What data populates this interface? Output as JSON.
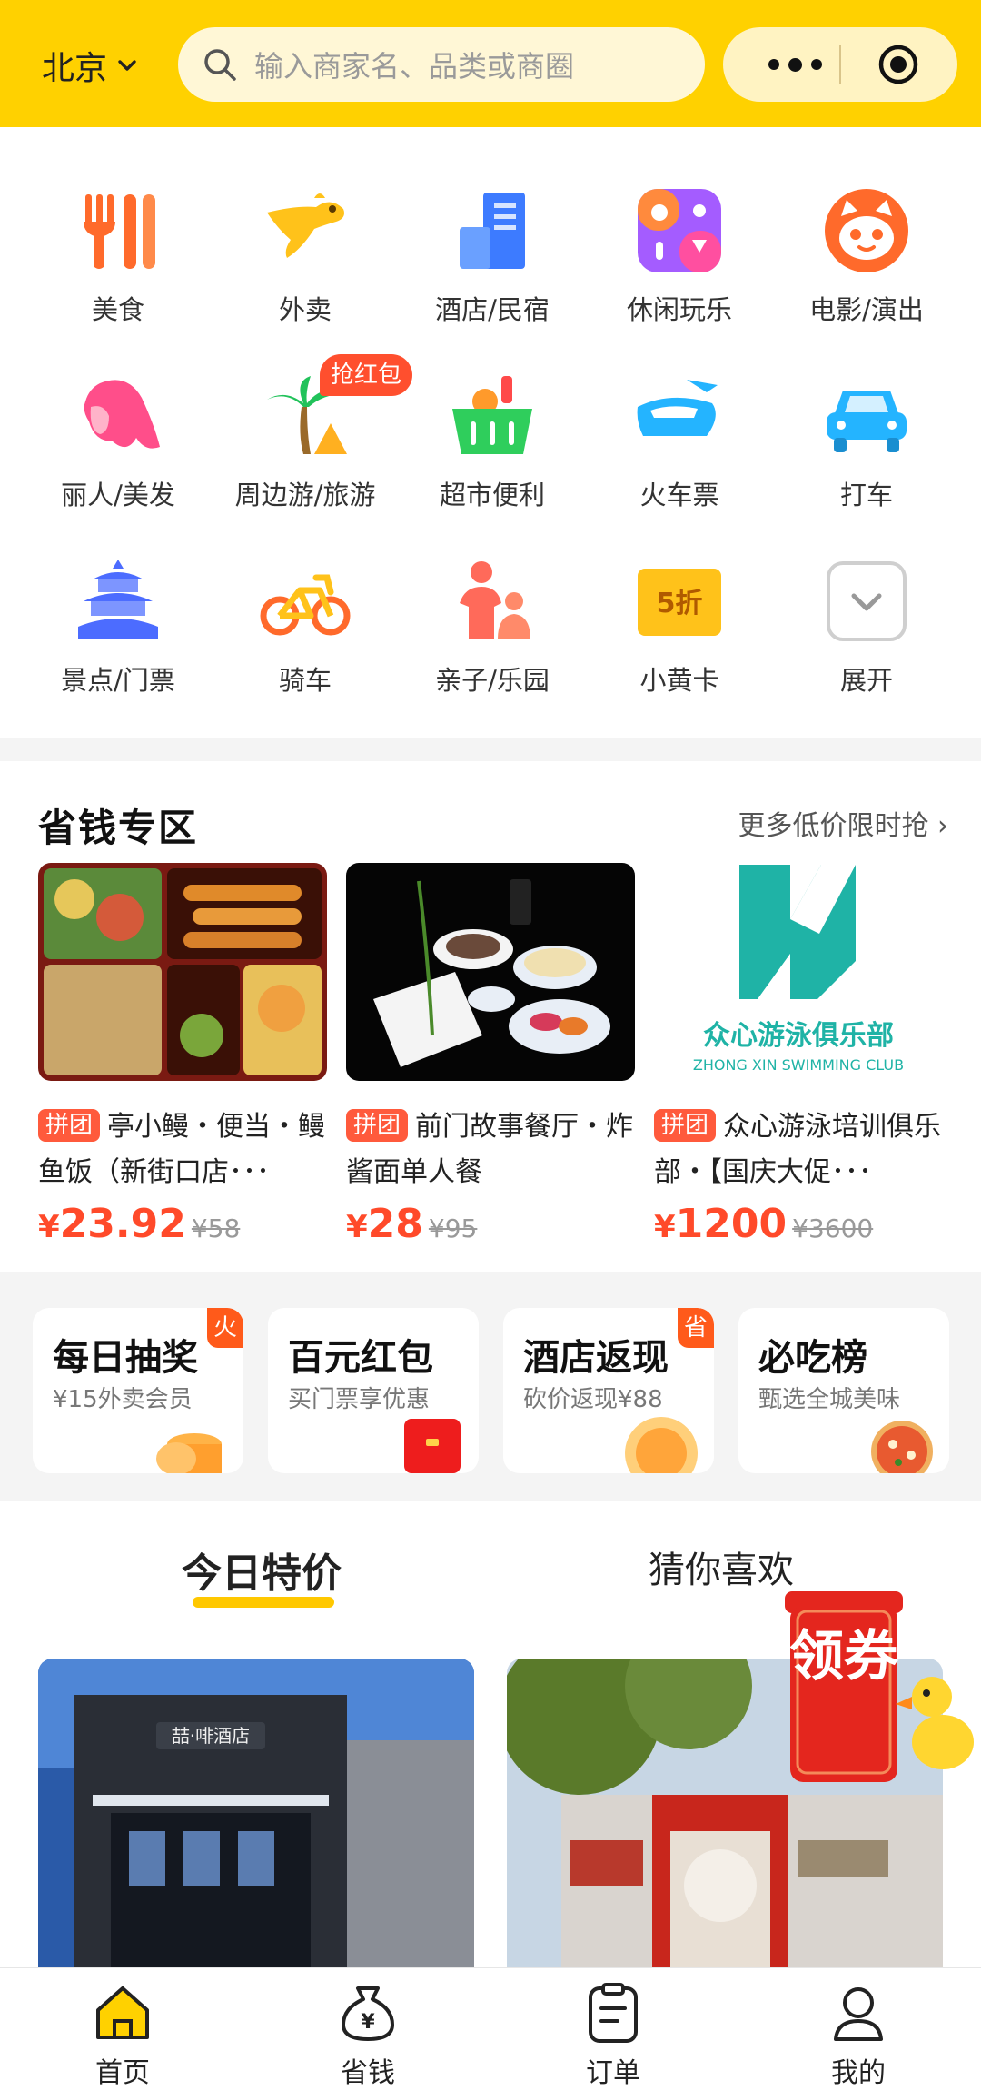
{
  "header": {
    "city": "北京",
    "search_placeholder": "输入商家名、品类或商圈",
    "colors": {
      "brand": "#ffd100"
    }
  },
  "categories": [
    {
      "label": "美食",
      "icon": "fork-knife-icon"
    },
    {
      "label": "外卖",
      "icon": "kangaroo-icon"
    },
    {
      "label": "酒店/民宿",
      "icon": "building-icon"
    },
    {
      "label": "休闲玩乐",
      "icon": "leisure-grid-icon"
    },
    {
      "label": "电影/演出",
      "icon": "cat-face-icon"
    },
    {
      "label": "丽人/美发",
      "icon": "woman-hair-icon"
    },
    {
      "label": "周边游/旅游",
      "icon": "palm-tree-icon",
      "badge": "抢红包"
    },
    {
      "label": "超市便利",
      "icon": "basket-icon"
    },
    {
      "label": "火车票",
      "icon": "train-icon"
    },
    {
      "label": "打车",
      "icon": "car-icon"
    },
    {
      "label": "景点/门票",
      "icon": "temple-icon"
    },
    {
      "label": "骑车",
      "icon": "bicycle-icon"
    },
    {
      "label": "亲子/乐园",
      "icon": "parent-child-icon"
    },
    {
      "label": "小黄卡",
      "icon": "yellow-card-icon",
      "card_text": "5折"
    },
    {
      "label": "展开",
      "icon": "expand-chevron-icon"
    }
  ],
  "savings": {
    "title": "省钱专区",
    "more": "更多低价限时抢",
    "deals": [
      {
        "tag": "拼团",
        "text": "亭小鳗・便当・鳗鱼饭（新街口店･･･",
        "currency": "¥",
        "price": "23.92",
        "original": "¥58"
      },
      {
        "tag": "拼团",
        "text": "前门故事餐厅・炸酱面单人餐",
        "currency": "¥",
        "price": "28",
        "original": "¥95"
      },
      {
        "tag": "拼团",
        "text": "众心游泳培训俱乐部・【国庆大促･･･",
        "currency": "¥",
        "price": "1200",
        "original": "¥3600",
        "logo_cn": "众心游泳俱乐部",
        "logo_en": "ZHONG XIN SWIMMING CLUB"
      }
    ]
  },
  "promos": [
    {
      "title": "每日抽奖",
      "subtitle": "¥15外卖会员",
      "corner": "火"
    },
    {
      "title": "百元红包",
      "subtitle": "买门票享优惠"
    },
    {
      "title": "酒店返现",
      "subtitle": "砍价返现¥88",
      "corner": "省"
    },
    {
      "title": "必吃榜",
      "subtitle": "甄选全城美味"
    }
  ],
  "tabs": [
    {
      "label": "今日特价",
      "active": true
    },
    {
      "label": "猜你喜欢",
      "active": false
    }
  ],
  "feed": {
    "card1_sign": "喆·啡酒店",
    "coupon_text": "领券"
  },
  "bottom_nav": [
    {
      "label": "首页",
      "icon": "home-icon",
      "active": true
    },
    {
      "label": "省钱",
      "icon": "money-bag-icon"
    },
    {
      "label": "订单",
      "icon": "order-list-icon"
    },
    {
      "label": "我的",
      "icon": "profile-icon"
    }
  ]
}
